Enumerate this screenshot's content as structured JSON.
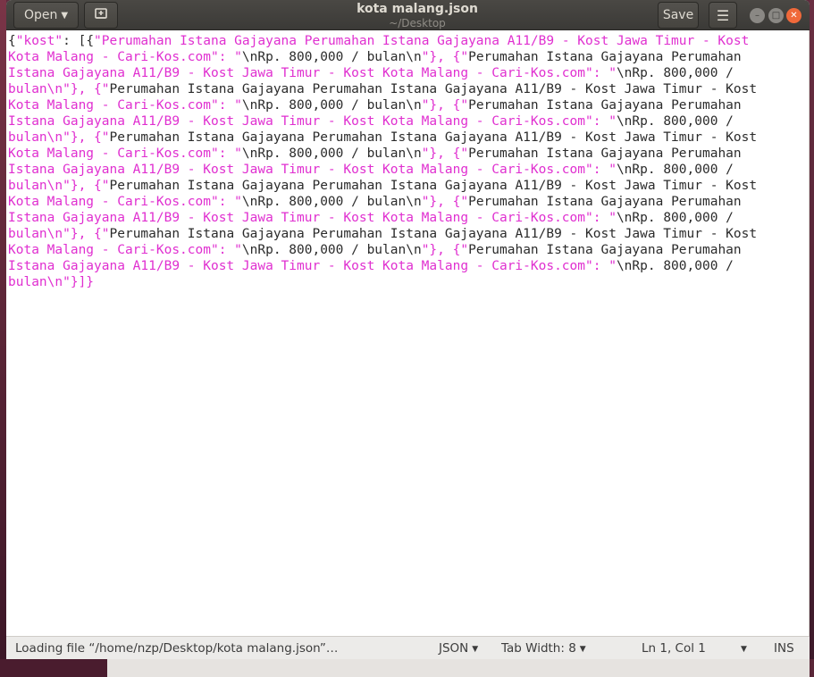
{
  "window": {
    "title": "kota malang.json",
    "subtitle": "~/Desktop"
  },
  "headerbar": {
    "open_label": "Open",
    "open_icon": "chevron-down-icon",
    "recent_icon": "document-pin-icon",
    "save_label": "Save",
    "menu_icon": "hamburger-menu-icon"
  },
  "editor": {
    "text_color": "#e02fd0",
    "lines": [
      "{\"kost\": [{\"Perumahan Istana Gajayana Perumahan Istana Gajayana A11/B9 - Kost Jawa Timur - Kost",
      "Kota Malang - Cari-Kos.com\": \"\\nRp. 800,000 / bulan\\n\"}, {\"Perumahan Istana Gajayana Perumahan",
      "Istana Gajayana A11/B9 - Kost Jawa Timur - Kost Kota Malang - Cari-Kos.com\": \"\\nRp. 800,000 /",
      "bulan\\n\"}, {\"Perumahan Istana Gajayana Perumahan Istana Gajayana A11/B9 - Kost Jawa Timur - Kost",
      "Kota Malang - Cari-Kos.com\": \"\\nRp. 800,000 / bulan\\n\"}, {\"Perumahan Istana Gajayana Perumahan",
      "Istana Gajayana A11/B9 - Kost Jawa Timur - Kost Kota Malang - Cari-Kos.com\": \"\\nRp. 800,000 /",
      "bulan\\n\"}, {\"Perumahan Istana Gajayana Perumahan Istana Gajayana A11/B9 - Kost Jawa Timur - Kost",
      "Kota Malang - Cari-Kos.com\": \"\\nRp. 800,000 / bulan\\n\"}, {\"Perumahan Istana Gajayana Perumahan",
      "Istana Gajayana A11/B9 - Kost Jawa Timur - Kost Kota Malang - Cari-Kos.com\": \"\\nRp. 800,000 /",
      "bulan\\n\"}, {\"Perumahan Istana Gajayana Perumahan Istana Gajayana A11/B9 - Kost Jawa Timur - Kost",
      "Kota Malang - Cari-Kos.com\": \"\\nRp. 800,000 / bulan\\n\"}, {\"Perumahan Istana Gajayana Perumahan",
      "Istana Gajayana A11/B9 - Kost Jawa Timur - Kost Kota Malang - Cari-Kos.com\": \"\\nRp. 800,000 /",
      "bulan\\n\"}, {\"Perumahan Istana Gajayana Perumahan Istana Gajayana A11/B9 - Kost Jawa Timur - Kost",
      "Kota Malang - Cari-Kos.com\": \"\\nRp. 800,000 / bulan\\n\"}, {\"Perumahan Istana Gajayana Perumahan",
      "Istana Gajayana A11/B9 - Kost Jawa Timur - Kost Kota Malang - Cari-Kos.com\": \"\\nRp. 800,000 /",
      "bulan\\n\"}]}"
    ]
  },
  "statusbar": {
    "message": "Loading file “/home/nzp/Desktop/kota malang.json”…",
    "language": "JSON",
    "tab_width": "Tab Width: 8",
    "position": "Ln 1, Col 1",
    "mode": "INS"
  }
}
